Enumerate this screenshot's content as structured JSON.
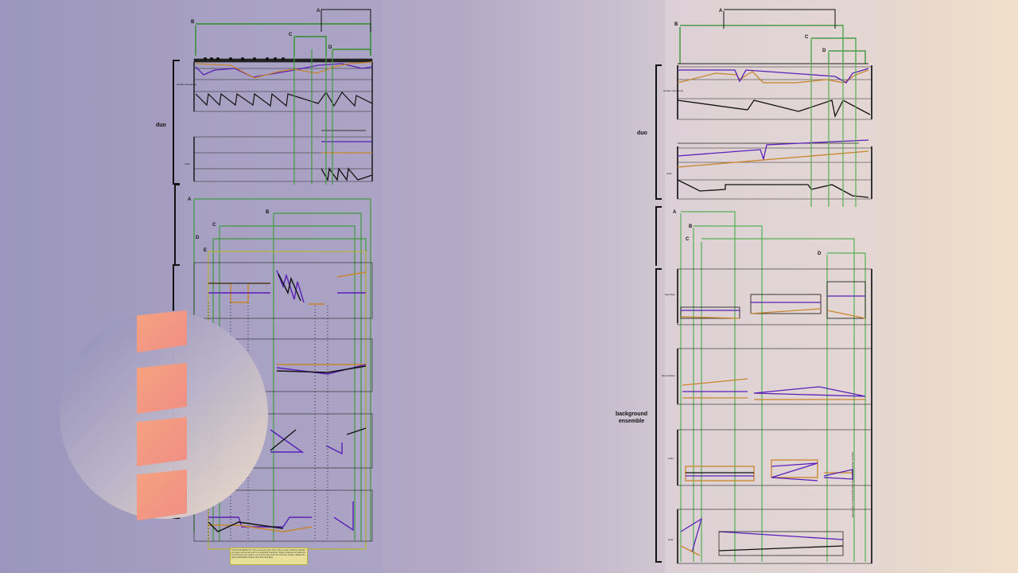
{
  "left_score": {
    "sections": {
      "duo": "duo"
    },
    "duo_markers": {
      "A": "A",
      "B": "B",
      "C": "C",
      "D": "D"
    },
    "ensemble_markers": {
      "A": "A",
      "B": "B",
      "C": "C",
      "D": "D",
      "E": "E"
    },
    "staff_labels": [
      "aeolian saxophone",
      "violin"
    ],
    "note_text": "NOTE FOR REPEAT 'D': Play it extremely fast. Play it with a circular breathing. Whether you play a strong instrument or a woodwind instrument. Strings: Seamless to sustain the tone whenever you restart - you only the tone of the line of the line. Please maintain the guide relationships between lines and avoid gaps."
  },
  "right_score": {
    "sections": {
      "duo": "duo",
      "background": "background ensemble"
    },
    "duo_markers": {
      "A": "A",
      "B": "B",
      "C": "C",
      "D": "D"
    },
    "ensemble_markers": {
      "A": "A",
      "B": "B",
      "C": "C",
      "D": "D"
    },
    "staff_labels": [
      "aeolian saxophone",
      "violin",
      "bass flute",
      "bass clarinet",
      "violin",
      "viola"
    ],
    "footer": "Exponentia 11 Flowerchild 2012 Stylus 12 December 14 2012"
  },
  "logo": {
    "name": "channel-logo",
    "bar_color": "#f39a83"
  }
}
